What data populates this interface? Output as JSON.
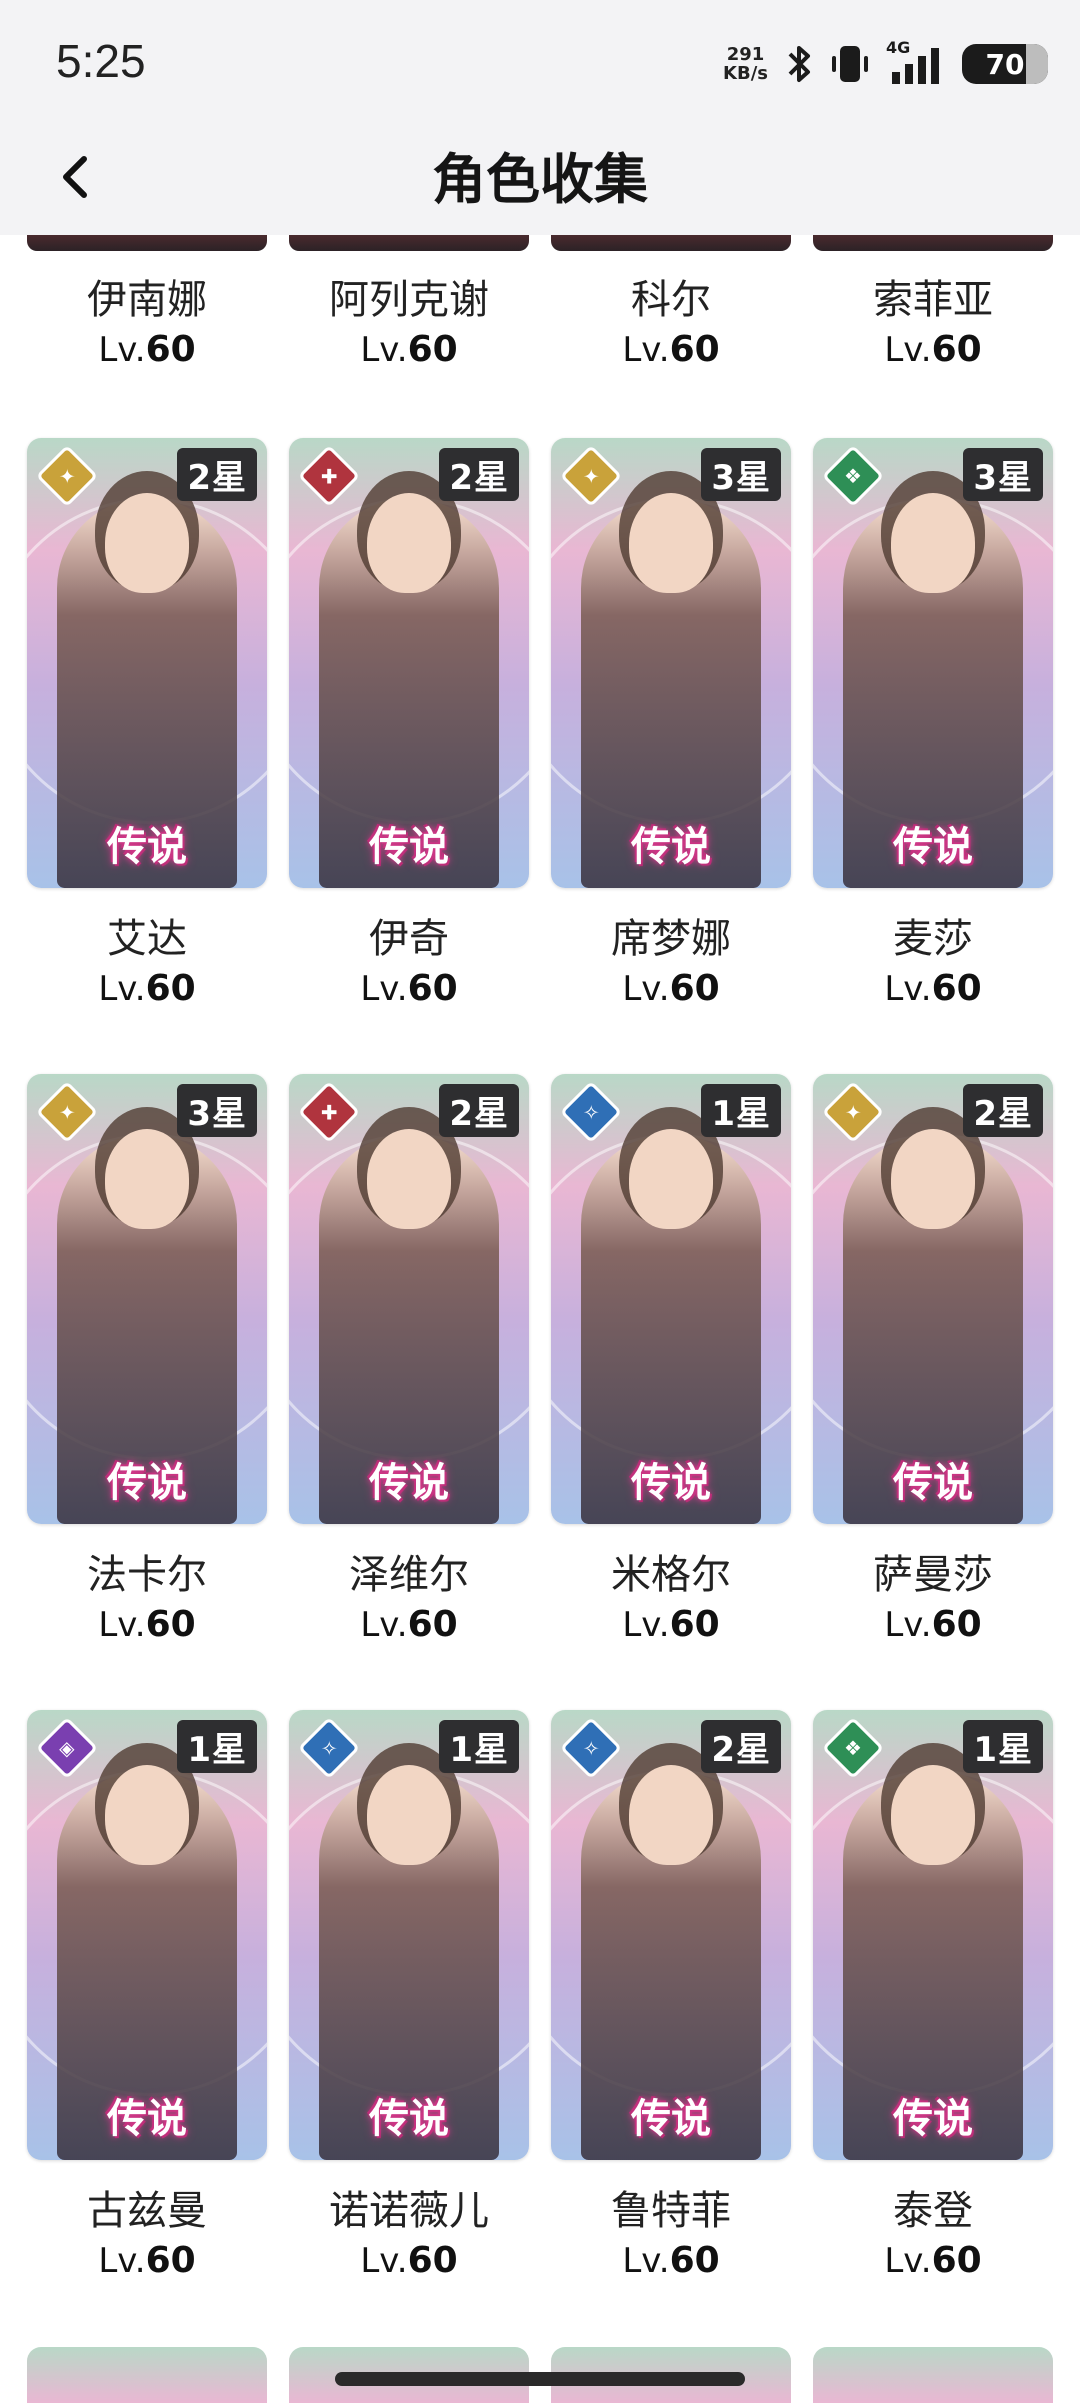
{
  "status": {
    "time": "5:25",
    "net_value": "291",
    "net_unit": "KB/s",
    "signal": "4G",
    "battery": "70"
  },
  "header": {
    "title": "角色收集"
  },
  "top_partial_row": [
    {
      "name": "伊南娜",
      "level_prefix": "Lv.",
      "level": "60"
    },
    {
      "name": "阿列克谢",
      "level_prefix": "Lv.",
      "level": "60"
    },
    {
      "name": "科尔",
      "level_prefix": "Lv.",
      "level": "60"
    },
    {
      "name": "索菲亚",
      "level_prefix": "Lv.",
      "level": "60"
    }
  ],
  "rows": [
    [
      {
        "name": "艾达",
        "stars": "2星",
        "badge": "传说",
        "element": "light",
        "level_prefix": "Lv.",
        "level": "60"
      },
      {
        "name": "伊奇",
        "stars": "2星",
        "badge": "传说",
        "element": "fire",
        "level_prefix": "Lv.",
        "level": "60"
      },
      {
        "name": "席梦娜",
        "stars": "3星",
        "badge": "传说",
        "element": "light",
        "level_prefix": "Lv.",
        "level": "60"
      },
      {
        "name": "麦莎",
        "stars": "3星",
        "badge": "传说",
        "element": "wind",
        "level_prefix": "Lv.",
        "level": "60"
      }
    ],
    [
      {
        "name": "法卡尔",
        "stars": "3星",
        "badge": "传说",
        "element": "light",
        "level_prefix": "Lv.",
        "level": "60"
      },
      {
        "name": "泽维尔",
        "stars": "2星",
        "badge": "传说",
        "element": "fire",
        "level_prefix": "Lv.",
        "level": "60"
      },
      {
        "name": "米格尔",
        "stars": "1星",
        "badge": "传说",
        "element": "water",
        "level_prefix": "Lv.",
        "level": "60"
      },
      {
        "name": "萨曼莎",
        "stars": "2星",
        "badge": "传说",
        "element": "light",
        "level_prefix": "Lv.",
        "level": "60"
      }
    ],
    [
      {
        "name": "古兹曼",
        "stars": "1星",
        "badge": "传说",
        "element": "dark",
        "level_prefix": "Lv.",
        "level": "60"
      },
      {
        "name": "诺诺薇儿",
        "stars": "1星",
        "badge": "传说",
        "element": "water",
        "level_prefix": "Lv.",
        "level": "60"
      },
      {
        "name": "鲁特菲",
        "stars": "2星",
        "badge": "传说",
        "element": "water",
        "level_prefix": "Lv.",
        "level": "60"
      },
      {
        "name": "泰登",
        "stars": "1星",
        "badge": "传说",
        "element": "wind",
        "level_prefix": "Lv.",
        "level": "60"
      }
    ]
  ],
  "colors": {
    "accent_badge": "#d23b8b",
    "star_tag": "#2e2e30"
  }
}
